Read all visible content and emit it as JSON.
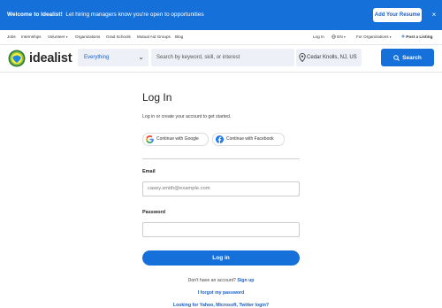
{
  "banner": {
    "welcome": "Welcome to Idealist!",
    "message": "Let hiring managers know you're open to opportunities",
    "button_label": "Add Your Resume",
    "close_glyph": "×"
  },
  "subnav": {
    "left": [
      "Jobs",
      "Internships",
      "Volunteer",
      "Organizations",
      "Grad Schools",
      "Mutual Aid Groups",
      "Blog"
    ],
    "login": "Log In",
    "language": "EN",
    "for_orgs": "For Organizations",
    "post_listing": "Post a Listing",
    "caret": "▾"
  },
  "header": {
    "brand": "idealist",
    "category_select": "Everything",
    "search_placeholder": "Search by keyword, skill, or interest",
    "location": "Cedar Knolls, NJ, US",
    "search_button": "Search",
    "chevron": "⌄"
  },
  "login": {
    "title": "Log In",
    "subtitle": "Log in or create your account to get started.",
    "google_label": "Continue with Google",
    "facebook_label": "Continue with Facebook",
    "email_label": "Email",
    "email_placeholder": "casey.smith@example.com",
    "password_label": "Password",
    "password_value": "",
    "submit_label": "Log in",
    "no_account_text": "Don't have an account?",
    "signup_link": "Sign up",
    "forgot_link": "I forgot my password",
    "other_logins_link": "Looking for Yahoo, Microsoft, Twitter login?"
  },
  "colors": {
    "brand_blue": "#1670d9",
    "link_blue": "#1b5fc4",
    "field_bg": "#edf1f7"
  },
  "icons": {
    "logo": "idealist-logo-icon",
    "location": "map-pin-icon",
    "search": "search-icon",
    "google": "google-icon",
    "facebook": "facebook-icon",
    "globe": "globe-icon",
    "close": "close-icon"
  }
}
